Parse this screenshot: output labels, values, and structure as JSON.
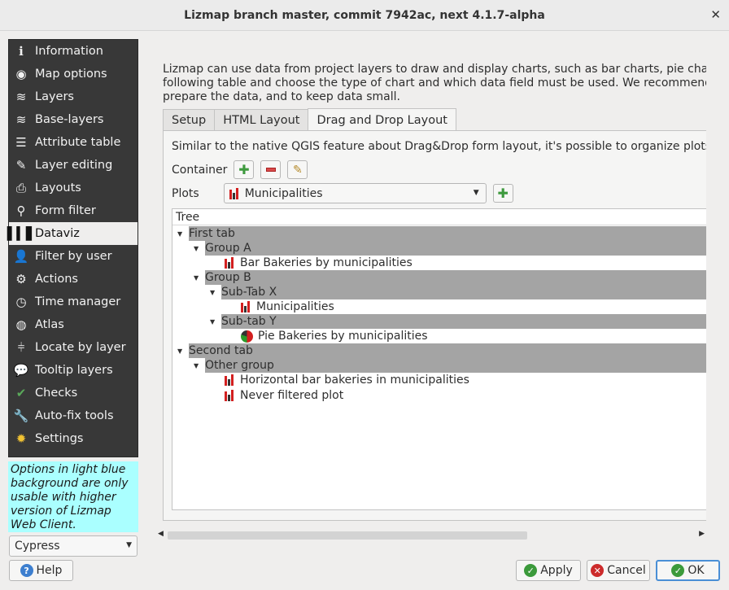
{
  "window": {
    "title": "Lizmap branch master, commit 7942ac, next 4.1.7-alpha"
  },
  "sidebar": {
    "items": [
      {
        "label": "Information",
        "icon": "info-icon"
      },
      {
        "label": "Map options",
        "icon": "globe-icon"
      },
      {
        "label": "Layers",
        "icon": "layers-icon"
      },
      {
        "label": "Base-layers",
        "icon": "base-layers-icon"
      },
      {
        "label": "Attribute table",
        "icon": "list-icon"
      },
      {
        "label": "Layer editing",
        "icon": "edit-icon"
      },
      {
        "label": "Layouts",
        "icon": "printer-icon"
      },
      {
        "label": "Form filter",
        "icon": "search-icon"
      },
      {
        "label": "Dataviz",
        "icon": "bar-chart-icon",
        "active": true
      },
      {
        "label": "Filter by user",
        "icon": "user-icon"
      },
      {
        "label": "Actions",
        "icon": "gear-icon"
      },
      {
        "label": "Time manager",
        "icon": "clock-icon"
      },
      {
        "label": "Atlas",
        "icon": "globe-icon"
      },
      {
        "label": "Locate by layer",
        "icon": "signpost-icon"
      },
      {
        "label": "Tooltip layers",
        "icon": "speech-bubble-icon"
      },
      {
        "label": "Checks",
        "icon": "checks-icon"
      },
      {
        "label": "Auto-fix tools",
        "icon": "wrench-icon"
      },
      {
        "label": "Settings",
        "icon": "sun-gear-icon"
      }
    ],
    "note": "Options in light blue background are only usable with higher version of Lizmap Web Client.",
    "theme_select": "Cypress",
    "help_label": "Help"
  },
  "main": {
    "intro_lines": [
      "Lizmap can use data from project layers to draw and display charts, such as bar charts, pie charts or",
      "following table and choose the type of chart and which data field must be used. We recommend to",
      "prepare the data, and to keep data small."
    ],
    "tabs": [
      "Setup",
      "HTML Layout",
      "Drag and Drop Layout"
    ],
    "dnd": {
      "description": "Similar to the native QGIS feature about Drag&Drop form layout, it's possible to organize plots in",
      "container_label": "Container",
      "plots_label": "Plots",
      "plots_selected": "Municipalities",
      "tree_header": "Tree",
      "tree": {
        "first_tab": "First tab",
        "group_a": "Group A",
        "bar_bakeries": "Bar Bakeries by municipalities",
        "group_b": "Group B",
        "subtab_x": "Sub-Tab X",
        "municipalities": "Municipalities",
        "subtab_y": "Sub-tab Y",
        "pie_bakeries": "Pie Bakeries by municipalities",
        "second_tab": "Second tab",
        "other_group": "Other group",
        "horizontal_bar": "Horizontal bar bakeries in municipalities",
        "never_filtered": "Never filtered plot"
      }
    }
  },
  "footer": {
    "apply": "Apply",
    "cancel": "Cancel",
    "ok": "OK"
  },
  "colors": {
    "sidebar_bg": "#383838",
    "note_bg": "#aaffff",
    "group_row": "#a4a4a4",
    "chart_red": "#d21f1f"
  }
}
